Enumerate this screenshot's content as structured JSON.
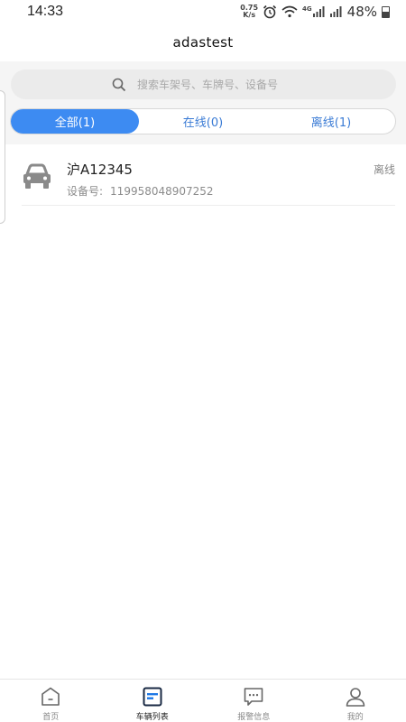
{
  "status_bar": {
    "time": "14:33",
    "net_speed_value": "0.75",
    "net_speed_unit": "K/s",
    "network_type": "4G",
    "battery": "48%"
  },
  "header": {
    "title": "adastest"
  },
  "search": {
    "placeholder": "搜索车架号、车牌号、设备号",
    "icon": "search-icon"
  },
  "tabs": [
    {
      "label": "全部(1)",
      "active": true
    },
    {
      "label": "在线(0)",
      "active": false
    },
    {
      "label": "离线(1)",
      "active": false
    }
  ],
  "vehicles": [
    {
      "plate": "沪A12345",
      "device_label": "设备号:",
      "device_id": "119958048907252",
      "status": "离线",
      "icon": "car-icon"
    }
  ],
  "bottom_nav": [
    {
      "label": "首页",
      "icon": "home-icon",
      "active": false
    },
    {
      "label": "车辆列表",
      "icon": "vehicle-list-icon",
      "active": true
    },
    {
      "label": "报警信息",
      "icon": "alarm-message-icon",
      "active": false
    },
    {
      "label": "我的",
      "icon": "profile-icon",
      "active": false
    }
  ],
  "colors": {
    "accent": "#3d8bf2",
    "tab_text": "#3a7bd5",
    "nav_active": "#1a4f9c"
  }
}
